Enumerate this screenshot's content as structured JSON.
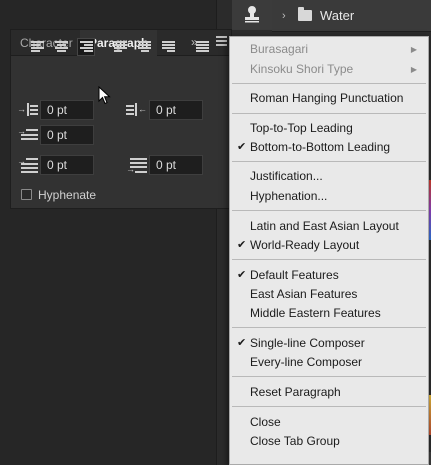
{
  "layers": {
    "group_name": "Water"
  },
  "panel": {
    "tabs": [
      {
        "label": "Character"
      },
      {
        "label": "Paragraph"
      }
    ],
    "active_tab": "Paragraph",
    "alignment_buttons": [
      "align-left",
      "align-center",
      "align-right",
      "justify-last-left",
      "justify-last-center",
      "justify-last-right",
      "justify-all"
    ],
    "active_alignment": "align-right",
    "fields": {
      "left_indent": "0 pt",
      "right_indent": "0 pt",
      "first_line_indent": "0 pt",
      "space_before": "0 pt",
      "space_after": "0 pt"
    },
    "hyphenate_label": "Hyphenate",
    "hyphenate_checked": false
  },
  "menu": {
    "items": [
      {
        "label": "Burasagari",
        "disabled": true,
        "submenu": true,
        "checked": false
      },
      {
        "label": "Kinsoku Shori Type",
        "disabled": true,
        "submenu": true,
        "checked": false
      },
      {
        "label": "Roman Hanging Punctuation",
        "disabled": false,
        "checked": false
      },
      {
        "label": "Top-to-Top Leading",
        "disabled": false,
        "checked": false
      },
      {
        "label": "Bottom-to-Bottom Leading",
        "disabled": false,
        "checked": true
      },
      {
        "label": "Justification...",
        "disabled": false,
        "checked": false
      },
      {
        "label": "Hyphenation...",
        "disabled": false,
        "checked": false
      },
      {
        "label": "Latin and East Asian Layout",
        "disabled": false,
        "checked": false
      },
      {
        "label": "World-Ready Layout",
        "disabled": false,
        "checked": true
      },
      {
        "label": "Default Features",
        "disabled": false,
        "checked": true
      },
      {
        "label": "East Asian Features",
        "disabled": false,
        "checked": false
      },
      {
        "label": "Middle Eastern Features",
        "disabled": false,
        "checked": false
      },
      {
        "label": "Single-line Composer",
        "disabled": false,
        "checked": true
      },
      {
        "label": "Every-line Composer",
        "disabled": false,
        "checked": false
      },
      {
        "label": "Reset Paragraph",
        "disabled": false,
        "checked": false
      },
      {
        "label": "Close",
        "disabled": false,
        "checked": false
      },
      {
        "label": "Close Tab Group",
        "disabled": false,
        "checked": false
      }
    ],
    "checkmark": "✔",
    "submenu_arrow": "▶"
  },
  "colors": {
    "menu_bg": "#e9e9e9",
    "panel_bg": "#323232",
    "app_bg": "#262626"
  }
}
